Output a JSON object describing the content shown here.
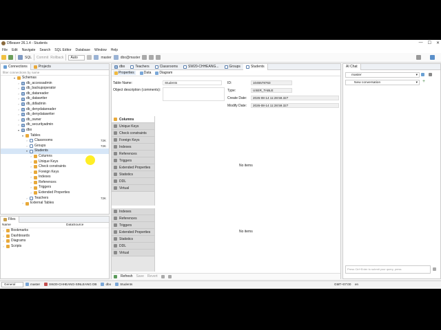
{
  "window": {
    "title": "DBeaver 26.1.4 - Students",
    "controls": [
      "—",
      "☐",
      "✕"
    ]
  },
  "menu": [
    "File",
    "Edit",
    "Navigate",
    "Search",
    "SQL Editor",
    "Database",
    "Window",
    "Help"
  ],
  "toolbar": {
    "sql_label": "SQL",
    "commit_label": "Commit",
    "rollback_label": "Rollback",
    "mode_value": "Auto",
    "database_value": "master",
    "schema_value": "dbo@master"
  },
  "left_panel": {
    "tabs": [
      "Connections",
      "Projects"
    ],
    "filter_placeholder": "filter connections by name",
    "tree": [
      {
        "label": "Schemas",
        "indent": 3,
        "icon": "folder",
        "arrow": "▾"
      },
      {
        "label": "db_accessadmin",
        "indent": 4,
        "icon": "schema",
        "arrow": "›"
      },
      {
        "label": "db_backupoperator",
        "indent": 4,
        "icon": "schema",
        "arrow": "›"
      },
      {
        "label": "db_datareader",
        "indent": 4,
        "icon": "schema",
        "arrow": "›"
      },
      {
        "label": "db_datawriter",
        "indent": 4,
        "icon": "schema",
        "arrow": "›"
      },
      {
        "label": "db_ddladmin",
        "indent": 4,
        "icon": "schema",
        "arrow": "›"
      },
      {
        "label": "db_denydatareader",
        "indent": 4,
        "icon": "schema",
        "arrow": "›"
      },
      {
        "label": "db_denydatawriter",
        "indent": 4,
        "icon": "schema",
        "arrow": "›"
      },
      {
        "label": "db_owner",
        "indent": 4,
        "icon": "schema",
        "arrow": "›"
      },
      {
        "label": "db_securityadmin",
        "indent": 4,
        "icon": "schema",
        "arrow": "›"
      },
      {
        "label": "dbo",
        "indent": 4,
        "icon": "schema",
        "arrow": "▾"
      },
      {
        "label": "Tables",
        "indent": 5,
        "icon": "folder",
        "arrow": "▾"
      },
      {
        "label": "Classrooms",
        "indent": 6,
        "icon": "table",
        "arrow": "›",
        "size": "72K"
      },
      {
        "label": "Groups",
        "indent": 6,
        "icon": "table",
        "arrow": "›",
        "size": "72K"
      },
      {
        "label": "Students",
        "indent": 6,
        "icon": "table",
        "arrow": "▾",
        "size": "",
        "selected": true
      },
      {
        "label": "Columns",
        "indent": 7,
        "icon": "folder",
        "arrow": "›"
      },
      {
        "label": "Unique Keys",
        "indent": 7,
        "icon": "folder",
        "arrow": "›"
      },
      {
        "label": "Check constraints",
        "indent": 7,
        "icon": "folder",
        "arrow": "›"
      },
      {
        "label": "Foreign Keys",
        "indent": 7,
        "icon": "folder",
        "arrow": "›"
      },
      {
        "label": "Indexes",
        "indent": 7,
        "icon": "folder",
        "arrow": "›"
      },
      {
        "label": "References",
        "indent": 7,
        "icon": "folder",
        "arrow": "›"
      },
      {
        "label": "Triggers",
        "indent": 7,
        "icon": "folder",
        "arrow": "›"
      },
      {
        "label": "Extended Properties",
        "indent": 7,
        "icon": "folder",
        "arrow": "›"
      },
      {
        "label": "Teachers",
        "indent": 6,
        "icon": "table",
        "arrow": "›",
        "size": "72K"
      },
      {
        "label": "External Tables",
        "indent": 5,
        "icon": "folder",
        "arrow": "›"
      },
      {
        "label": "Views",
        "indent": 5,
        "icon": "folder",
        "arrow": "›"
      }
    ]
  },
  "files_panel": {
    "title": "Files",
    "col_name": "Name",
    "col_datasource": "DataSource",
    "items": [
      "Bookmarks",
      "Dashboards",
      "Diagrams",
      "Scripts"
    ]
  },
  "editor_tabs": [
    {
      "label": "dbo",
      "active": false
    },
    {
      "label": "Teachers",
      "active": false
    },
    {
      "label": "Classrooms",
      "active": false
    },
    {
      "label": "SW20-CHHEANG...",
      "active": false
    },
    {
      "label": "Groups",
      "active": false
    },
    {
      "label": "Students",
      "active": true
    }
  ],
  "editor": {
    "subtabs": [
      "Properties",
      "Data",
      "Diagram"
    ],
    "table_name_label": "Table Name:",
    "table_name_value": "Students",
    "description_label": "Object description (comments):",
    "id_label": "ID:",
    "id_value": "1045578763",
    "type_label": "Type:",
    "type_value": "USER_TABLE",
    "create_label": "Create Date:",
    "create_value": "2026-08-14 11:28:59.327",
    "modify_label": "Modify Date:",
    "modify_value": "2026-08-14 11:28:59.327",
    "sections_top": [
      "Columns",
      "Unique Keys",
      "Check constraints",
      "Foreign Keys",
      "Indexes",
      "References",
      "Triggers",
      "Extended Properties",
      "Statistics",
      "DDL",
      "Virtual"
    ],
    "sections_bottom": [
      "Indexes",
      "References",
      "Triggers",
      "Extended Properties",
      "Statistics",
      "DDL",
      "Virtual"
    ],
    "no_items": "No items",
    "bottom_bar": {
      "refresh": "Refresh",
      "save": "Save",
      "revert": "Revert"
    }
  },
  "ai_chat": {
    "tab": "AI Chat",
    "database": "master",
    "conversation": "New conversation",
    "input_placeholder": "Press Ctrl+Enter to submit your query, press"
  },
  "status": {
    "mode": "General",
    "db": "master",
    "connection": "SW20-CHHEANG-SINLEANG DB",
    "schema": "dbo",
    "table": "Students",
    "timezone": "GMT+07:00",
    "lang": "en"
  }
}
